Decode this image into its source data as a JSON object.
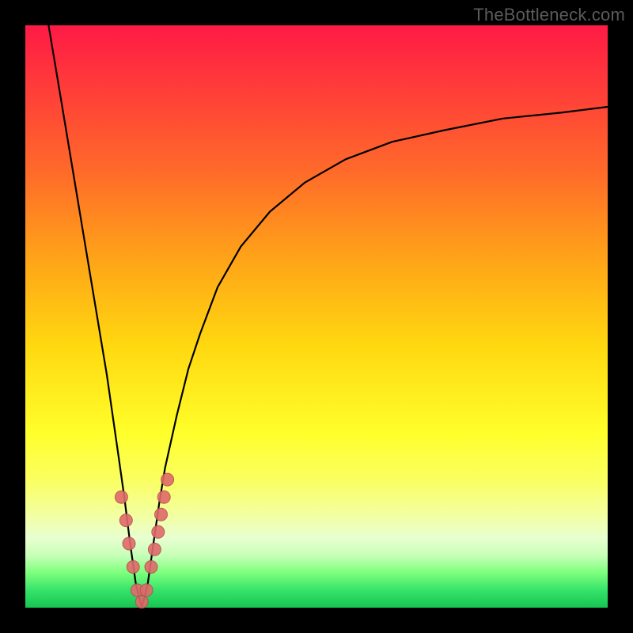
{
  "watermark": "TheBottleneck.com",
  "colors": {
    "frame": "#000000",
    "curve": "#000000",
    "marker_fill": "#e06a6a",
    "marker_stroke": "#b24f4f",
    "gradient_top": "#ff1a45",
    "gradient_bottom": "#16c552"
  },
  "chart_data": {
    "type": "line",
    "title": "",
    "xlabel": "",
    "ylabel": "",
    "xlim": [
      0,
      100
    ],
    "ylim": [
      0,
      100
    ],
    "x_optimum": 20,
    "series": [
      {
        "name": "bottleneck-curve",
        "x": [
          4,
          6,
          8,
          10,
          12,
          14,
          16,
          17,
          18,
          19,
          20,
          21,
          22,
          23,
          24,
          26,
          28,
          30,
          33,
          37,
          42,
          48,
          55,
          63,
          72,
          82,
          92,
          100
        ],
        "y": [
          100,
          88,
          76,
          64,
          52,
          40,
          26,
          19,
          11,
          4,
          0,
          4,
          11,
          18,
          24,
          33,
          41,
          47,
          55,
          62,
          68,
          73,
          77,
          80,
          82,
          84,
          85,
          86
        ]
      }
    ],
    "markers": {
      "name": "highlighted-points",
      "x": [
        16.5,
        17.3,
        17.8,
        18.5,
        19.2,
        20.0,
        20.8,
        21.6,
        22.2,
        22.8,
        23.3,
        23.8,
        24.4
      ],
      "y": [
        19,
        15,
        11,
        7,
        3,
        1,
        3,
        7,
        10,
        13,
        16,
        19,
        22
      ],
      "radius": 8
    },
    "annotations": [
      {
        "text": "TheBottleneck.com",
        "position": "top-right"
      }
    ]
  }
}
